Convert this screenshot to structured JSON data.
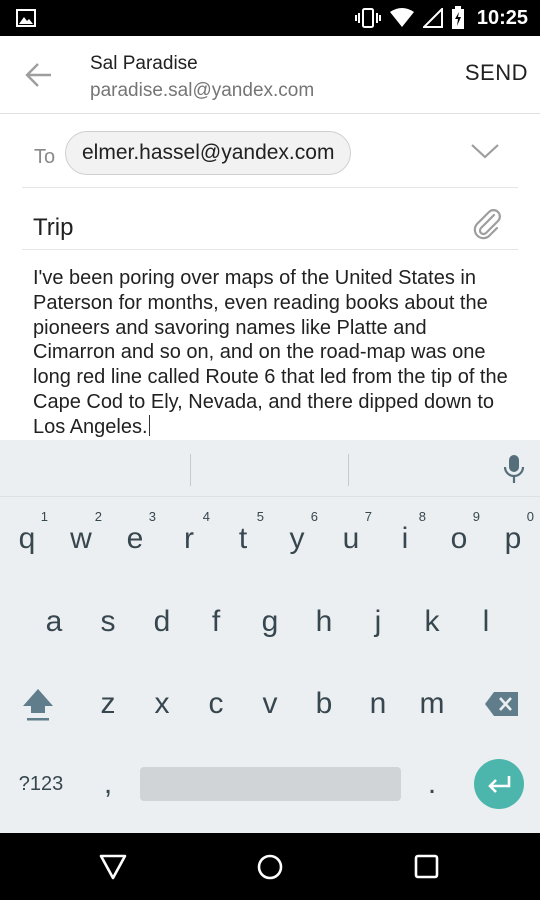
{
  "status_bar": {
    "time": "10:25"
  },
  "header": {
    "sender_name": "Sal Paradise",
    "sender_email": "paradise.sal@yandex.com",
    "send_label": "SEND"
  },
  "compose": {
    "to_label": "To",
    "recipient": "elmer.hassel@yandex.com",
    "subject": "Trip",
    "body": "I've been poring over maps of the United States in Paterson for months, even reading books about the pioneers and savoring names like Platte and Cimarron and so on, and on the road-map was one long red line called Route 6 that led from the tip of the Cape Cod to Ely, Nevada, and there dipped down to Los Angeles."
  },
  "keyboard": {
    "row1": [
      {
        "key": "q",
        "hint": "1"
      },
      {
        "key": "w",
        "hint": "2"
      },
      {
        "key": "e",
        "hint": "3"
      },
      {
        "key": "r",
        "hint": "4"
      },
      {
        "key": "t",
        "hint": "5"
      },
      {
        "key": "y",
        "hint": "6"
      },
      {
        "key": "u",
        "hint": "7"
      },
      {
        "key": "i",
        "hint": "8"
      },
      {
        "key": "o",
        "hint": "9"
      },
      {
        "key": "p",
        "hint": "0"
      }
    ],
    "row2": [
      "a",
      "s",
      "d",
      "f",
      "g",
      "h",
      "j",
      "k",
      "l"
    ],
    "row3": [
      "z",
      "x",
      "c",
      "v",
      "b",
      "n",
      "m"
    ],
    "symbols_label": "?123",
    "comma": ",",
    "period": "."
  },
  "colors": {
    "accent": "#4db6ac",
    "keyboard_bg": "#eceff1",
    "key_text": "#37474f"
  }
}
